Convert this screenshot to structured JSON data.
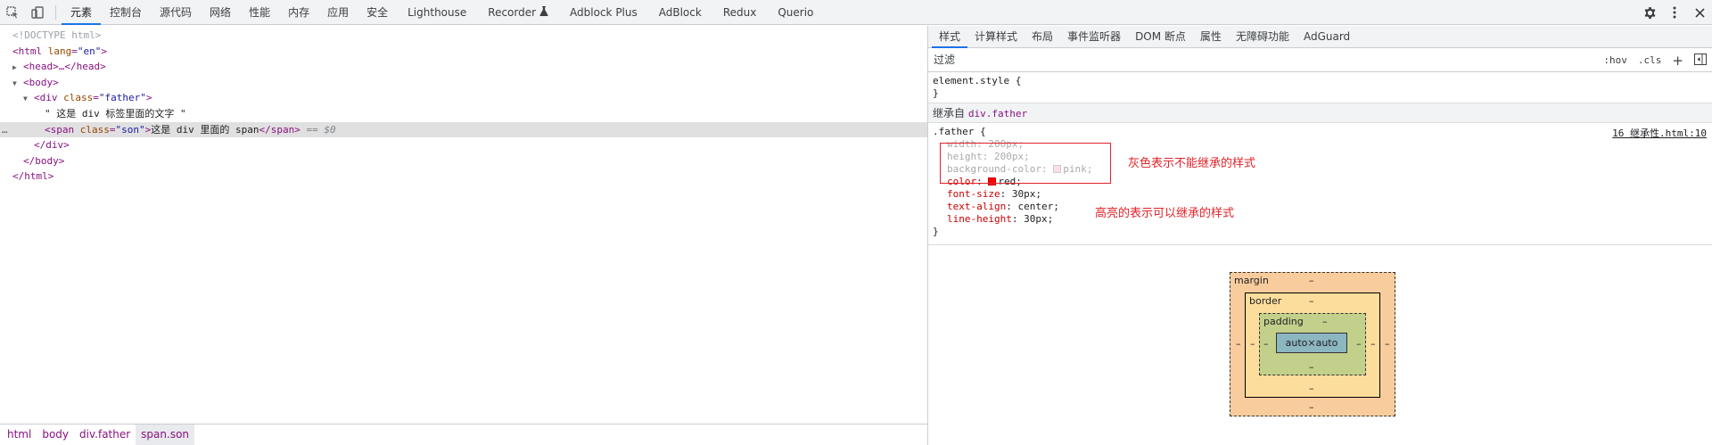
{
  "toolbar": {
    "tabs": [
      "元素",
      "控制台",
      "源代码",
      "网络",
      "性能",
      "内存",
      "应用",
      "安全",
      "Lighthouse",
      "Recorder",
      "Adblock Plus",
      "AdBlock",
      "Redux",
      "Querio"
    ],
    "recorder_icon": "flask-icon",
    "icons": [
      "inspect-icon",
      "device-toggle-icon",
      "gear-icon",
      "kebab-menu-icon",
      "close-icon"
    ]
  },
  "elements": {
    "doctype": "<!DOCTYPE html>",
    "html_open_tag": "html",
    "html_lang_attr": "lang",
    "html_lang_val": "\"en\"",
    "head_line": "<head>…</head>",
    "body_open": "<body>",
    "div_tag": "div",
    "div_class_attr": "class",
    "div_class_val": "\"father\"",
    "text_node": "\" 这是 div 标签里面的文字 \"",
    "span_tag": "span",
    "span_class_attr": "class",
    "span_class_val": "\"son\"",
    "span_text": "这是 div 里面的 span",
    "span_close": "</span>",
    "eq0": "== $0",
    "div_close": "</div>",
    "body_close": "</body>",
    "html_close": "</html>",
    "dots": "…"
  },
  "breadcrumbs": [
    "html",
    "body",
    "div.father",
    "span.son"
  ],
  "styles": {
    "subtabs": [
      "样式",
      "计算样式",
      "布局",
      "事件监听器",
      "DOM 断点",
      "属性",
      "无障碍功能",
      "AdGuard"
    ],
    "filter_placeholder": "过滤",
    "hov": ":hov",
    "cls": ".cls",
    "plus": "+",
    "element_style": "element.style {",
    "close_brace": "}",
    "inherited_from": "继承自",
    "inherited_selector": "div.father",
    "father_rule": ".father {",
    "source_link": "16 继承性.html:10",
    "grayed_props": [
      {
        "name": "width",
        "value": "200px;"
      },
      {
        "name": "height",
        "value": "200px;"
      },
      {
        "name": "background-color",
        "value": "pink;",
        "swatch": "#ffc0cb"
      }
    ],
    "active_props": [
      {
        "name": "color",
        "value": "red;",
        "swatch": "#ff0000"
      },
      {
        "name": "font-size",
        "value": "30px;"
      },
      {
        "name": "text-align",
        "value": "center;"
      },
      {
        "name": "line-height",
        "value": "30px;"
      }
    ],
    "annotation_gray": "灰色表示不能继承的样式",
    "annotation_highlight": "高亮的表示可以继承的样式"
  },
  "box_model": {
    "margin": "margin",
    "border": "border",
    "padding": "padding",
    "content": "auto×auto",
    "dash": "–",
    "colors": {
      "margin": "#f9cc9d",
      "border": "#fddd9b",
      "padding": "#c3d08b",
      "content": "#8cb6c0"
    }
  }
}
